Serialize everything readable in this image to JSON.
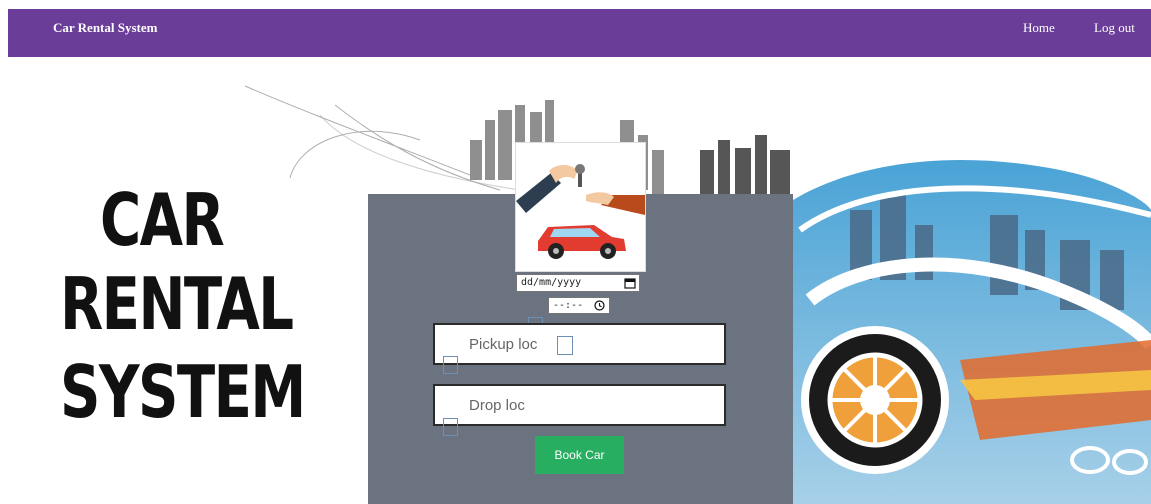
{
  "navbar": {
    "brand": "Car Rental System",
    "links": [
      "Home",
      "Log out"
    ],
    "color": "#6a3d98"
  },
  "hero": {
    "title_lines": [
      "CAR",
      "RENTAL",
      "SYSTEM"
    ]
  },
  "booking_form": {
    "date_placeholder": "dd/mm/yyyy",
    "time_placeholder": "--:--",
    "pickup_placeholder": "Pickup loc",
    "drop_placeholder": "Drop loc",
    "submit_label": "Book Car",
    "panel_color": "#6b7380",
    "button_color": "#27ae60"
  },
  "icons": {
    "calendar": "calendar-icon",
    "clock": "clock-icon"
  }
}
